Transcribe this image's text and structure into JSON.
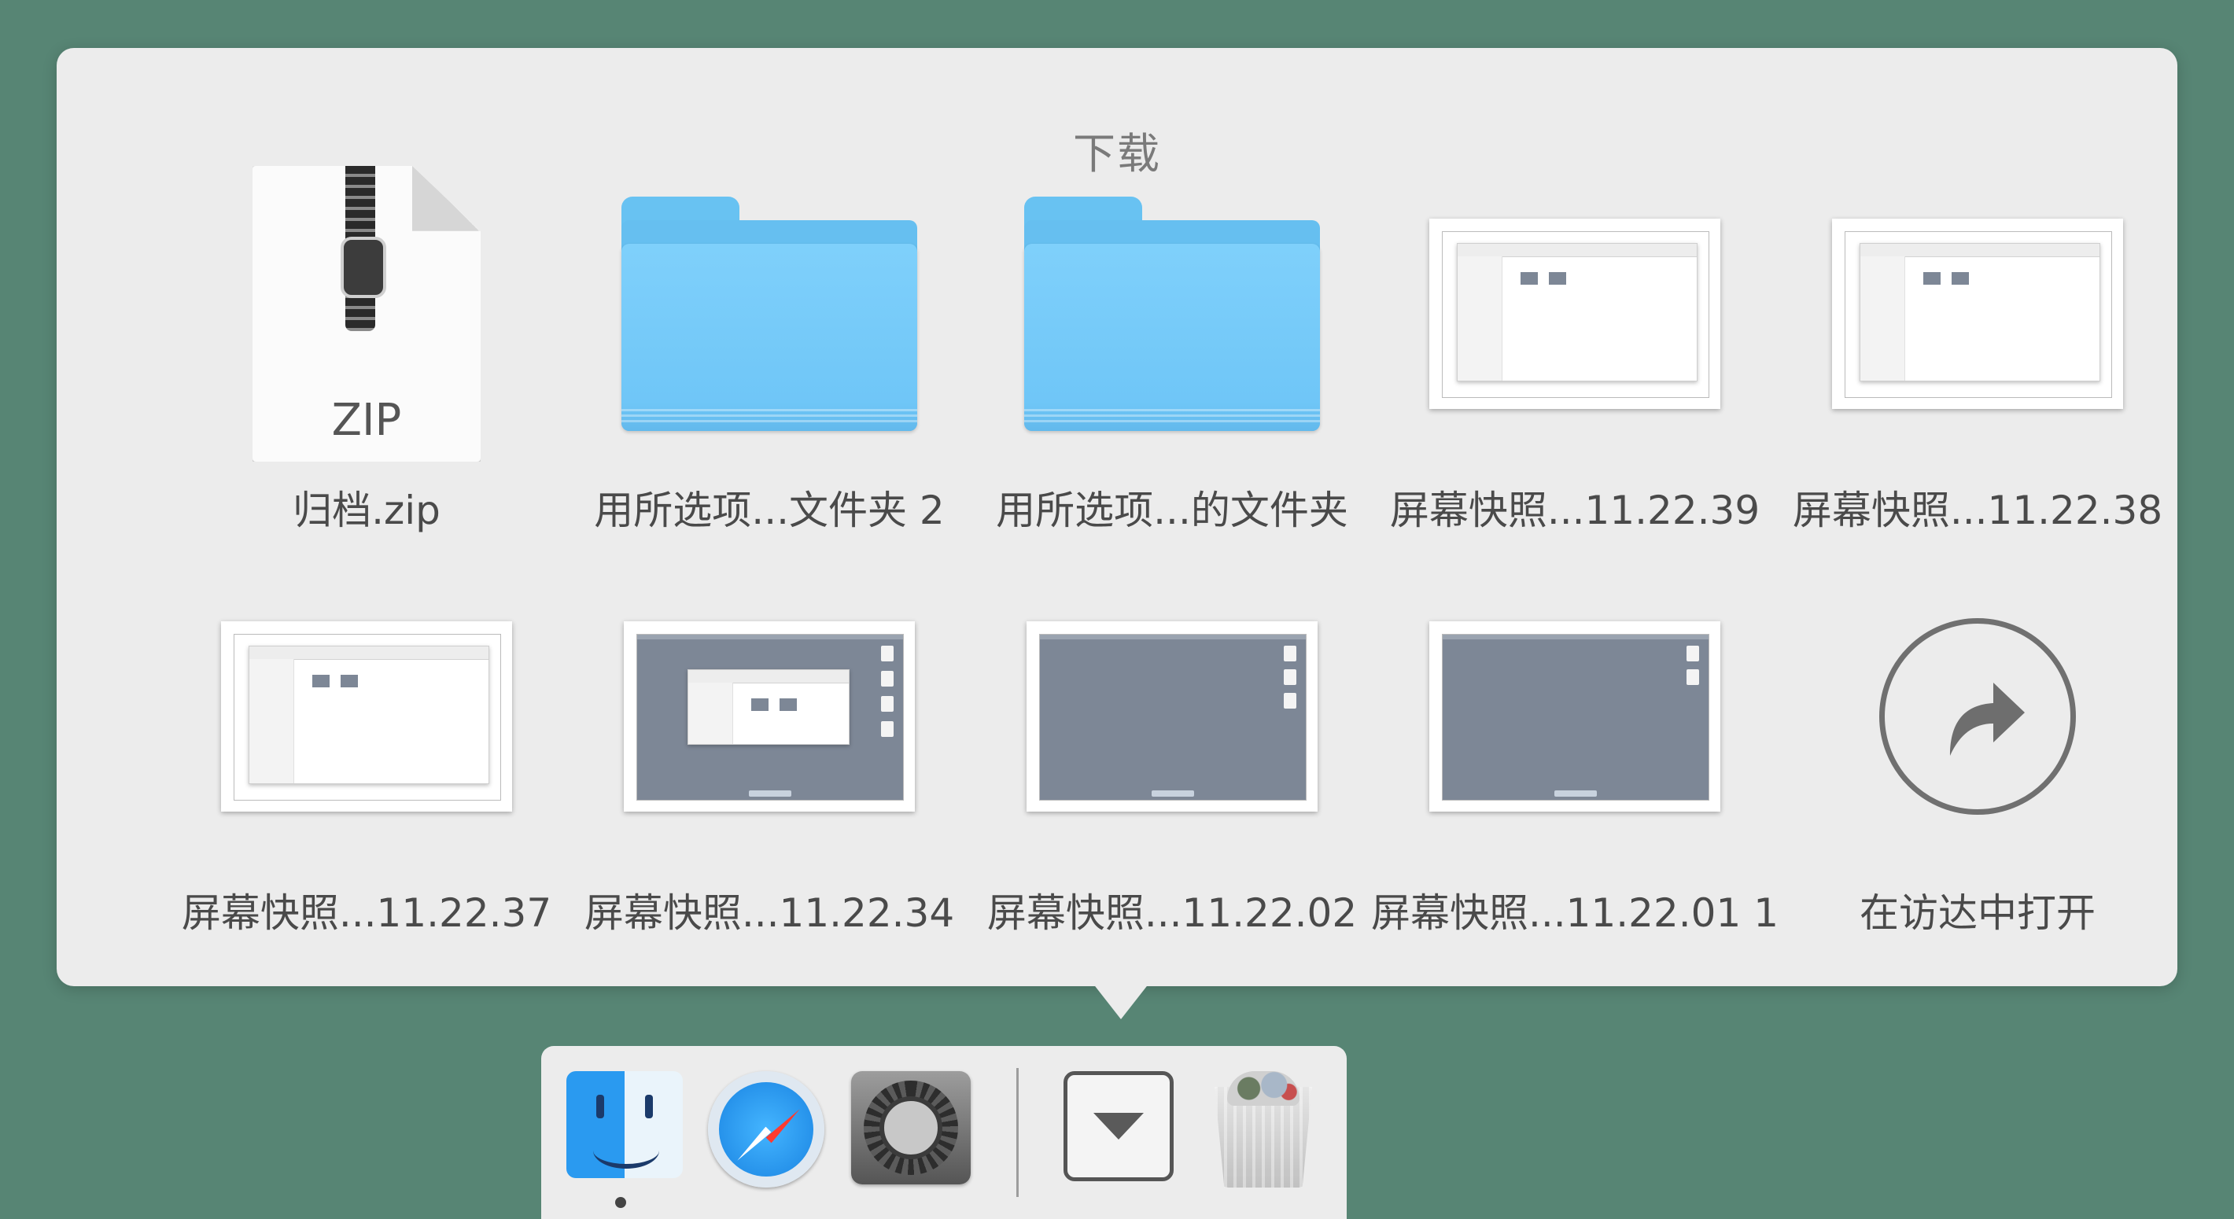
{
  "popover": {
    "title": "下载",
    "items": [
      {
        "label": "归档.zip",
        "kind": "zip",
        "badge": "ZIP"
      },
      {
        "label": "用所选项...文件夹 2",
        "kind": "folder"
      },
      {
        "label": "用所选项...的文件夹",
        "kind": "folder"
      },
      {
        "label": "屏幕快照...11.22.39",
        "kind": "screenshot-window"
      },
      {
        "label": "屏幕快照...11.22.38",
        "kind": "screenshot-window"
      },
      {
        "label": "屏幕快照...11.22.37",
        "kind": "screenshot-window"
      },
      {
        "label": "屏幕快照...11.22.34",
        "kind": "screenshot-desktop-window"
      },
      {
        "label": "屏幕快照...11.22.02",
        "kind": "screenshot-desktop"
      },
      {
        "label": "屏幕快照...11.22.01 1",
        "kind": "screenshot-desktop"
      },
      {
        "label": "在访达中打开",
        "kind": "open-in-finder"
      }
    ]
  },
  "dock": {
    "apps": [
      {
        "icon": "finder-icon",
        "running": true
      },
      {
        "icon": "safari-icon",
        "running": false
      },
      {
        "icon": "system-preferences-icon",
        "running": false
      },
      {
        "icon": "downloads-stack-icon",
        "running": false
      },
      {
        "icon": "trash-icon",
        "running": false
      }
    ]
  },
  "colors": {
    "desktop": "#578574",
    "panel": "#ececec",
    "folder": "#74c9f8",
    "label": "#4a4a4a"
  }
}
